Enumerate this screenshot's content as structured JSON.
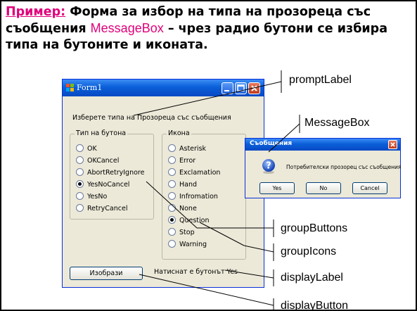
{
  "heading": {
    "keyword": "Пример:",
    "text1": " Форма за избор на типа на прозореца със съобщения ",
    "messagebox": "MessageBox",
    "text2": " – чрез радио бутони се избира типа на бутоните и иконата."
  },
  "form1": {
    "title": "Form1",
    "prompt": "Изберете типа на Прозореца със съобщения",
    "button_group": {
      "title": "Тип на бутона",
      "options": [
        "OK",
        "OKCancel",
        "AbortRetryIgnore",
        "YesNoCancel",
        "YesNo",
        "RetryCancel"
      ],
      "selected": "YesNoCancel"
    },
    "icon_group": {
      "title": "Икона",
      "options": [
        "Asterisk",
        "Error",
        "Exclamation",
        "Hand",
        "Infromation",
        "None",
        "Question",
        "Stop",
        "Warning"
      ],
      "selected": "Question"
    },
    "display_button": "Изобрази",
    "display_label": "Натиснат е бутонът Yes"
  },
  "messagebox": {
    "title": "Съобщения",
    "text": "Потребителски прозорец със съобщения",
    "buttons": [
      "Yes",
      "No",
      "Cancel"
    ],
    "icon": "question-icon"
  },
  "callouts": [
    "promptLabel",
    "MessageBox",
    "groupButtons",
    "groupIcons",
    "displayLabel",
    "displayButton"
  ]
}
